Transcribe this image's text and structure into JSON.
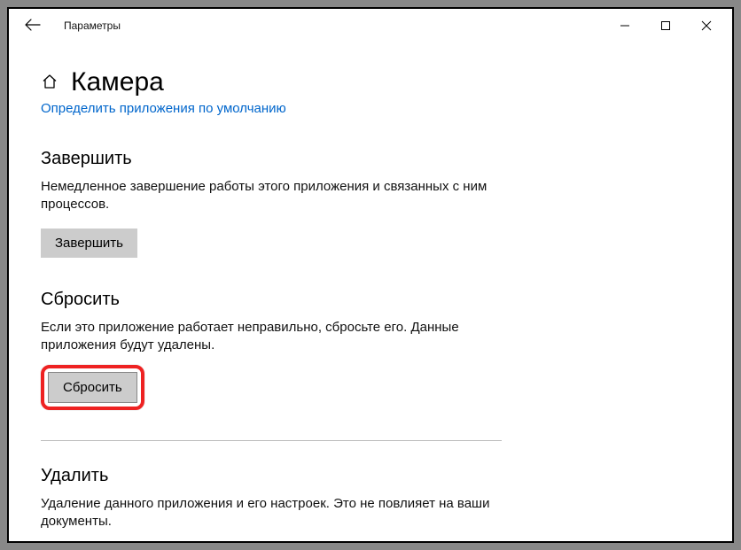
{
  "window": {
    "title": "Параметры"
  },
  "page": {
    "title": "Камера",
    "default_apps_link": "Определить приложения по умолчанию"
  },
  "sections": {
    "terminate": {
      "title": "Завершить",
      "desc": "Немедленное завершение работы этого приложения и связанных с ним процессов.",
      "button": "Завершить"
    },
    "reset": {
      "title": "Сбросить",
      "desc": "Если это приложение работает неправильно, сбросьте его. Данные приложения будут удалены.",
      "button": "Сбросить"
    },
    "uninstall": {
      "title": "Удалить",
      "desc": "Удаление данного приложения и его настроек. Это не повлияет на ваши документы."
    }
  }
}
